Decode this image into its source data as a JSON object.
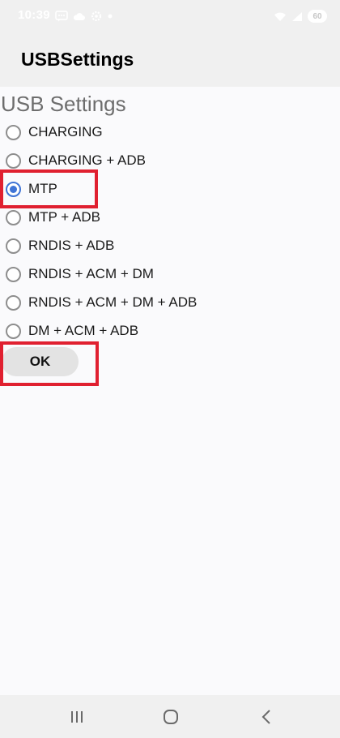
{
  "status_bar": {
    "time": "10:39",
    "battery_level": "60"
  },
  "app_bar": {
    "title": "USBSettings"
  },
  "settings": {
    "section_title": "USB Settings",
    "options": [
      {
        "label": "CHARGING",
        "selected": false
      },
      {
        "label": "CHARGING + ADB",
        "selected": false
      },
      {
        "label": "MTP",
        "selected": true
      },
      {
        "label": "MTP + ADB",
        "selected": false
      },
      {
        "label": "RNDIS + ADB",
        "selected": false
      },
      {
        "label": "RNDIS + ACM + DM",
        "selected": false
      },
      {
        "label": "RNDIS + ACM + DM + ADB",
        "selected": false
      },
      {
        "label": "DM + ACM + ADB",
        "selected": false
      }
    ],
    "ok_label": "OK"
  },
  "colors": {
    "accent": "#3f74d6",
    "highlight": "#e02030"
  },
  "icons": {
    "status_left": [
      "chat-icon",
      "cloud-icon",
      "settings-icon",
      "dot-icon"
    ],
    "status_right": [
      "wifi-icon",
      "signal-icon",
      "battery-icon"
    ],
    "navigation": [
      "recent-apps-icon",
      "home-icon",
      "back-icon"
    ]
  }
}
